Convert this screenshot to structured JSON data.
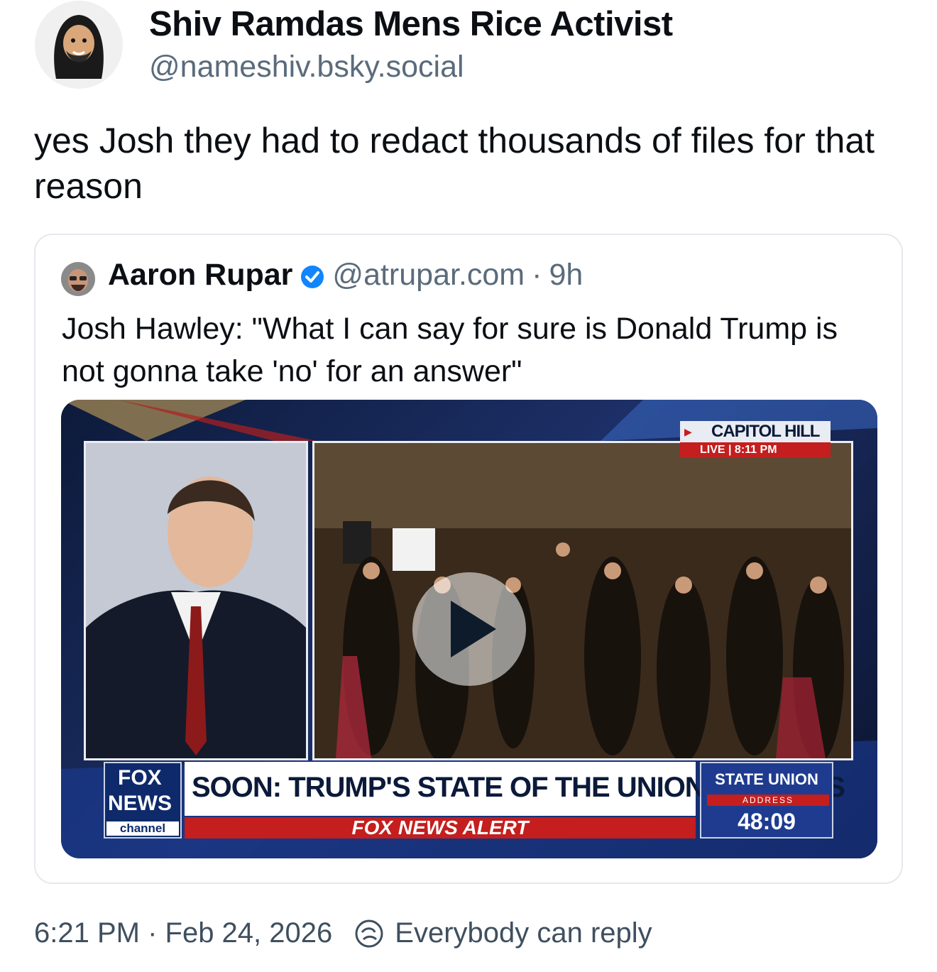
{
  "post": {
    "author_name": "Shiv Ramdas Mens Rice Activist",
    "author_handle": "@nameshiv.bsky.social",
    "text": "yes Josh they had to redact thousands of files for that reason"
  },
  "quote": {
    "author_name": "Aaron Rupar",
    "handle": "@atrupar.com",
    "separator": "·",
    "time": "9h",
    "text": "Josh Hawley: \"What I can say for sure is Donald Trump is not gonna take 'no' for an answer\"",
    "video": {
      "location": "CAPITOL HILL",
      "live": "LIVE | 8:11 PM",
      "logo_top": "FOX",
      "logo_mid": "NEWS",
      "logo_bottom": "channel",
      "headline": "SOON: TRUMP'S STATE OF THE UNION ADDRESS",
      "alert": "FOX NEWS ALERT",
      "sotu_title": "STATE UNION",
      "sotu_sub": "ADDRESS",
      "timer": "48:09"
    }
  },
  "footer": {
    "timestamp": "6:21 PM · Feb 24, 2026",
    "reply_setting": "Everybody can reply",
    "reply_icon": "reply-setting-icon"
  },
  "colors": {
    "verified": "#1185fe",
    "secondary_text": "#5a6b7b",
    "border": "#e4e8ec"
  }
}
